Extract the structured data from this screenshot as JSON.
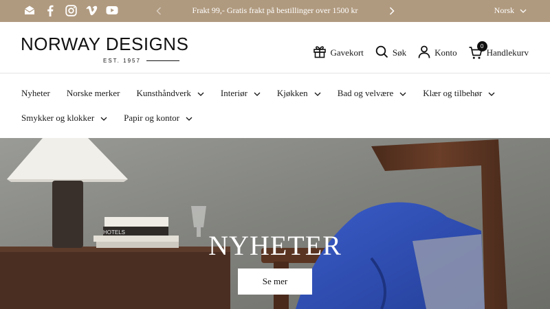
{
  "announcement": {
    "text": "Frakt 99,- Gratis frakt på bestillinger over 1500 kr",
    "language": "Norsk",
    "social_icons": [
      "email-icon",
      "facebook-icon",
      "instagram-icon",
      "vimeo-icon",
      "youtube-icon"
    ]
  },
  "header": {
    "logo_title": "NORWAY DESIGNS",
    "logo_subtitle": "EST. 1957",
    "gift_card": "Gavekort",
    "search": "Søk",
    "account": "Konto",
    "cart": "Handlekurv",
    "cart_count": "0"
  },
  "nav": {
    "items": [
      {
        "label": "Nyheter"
      },
      {
        "label": "Norske merker"
      },
      {
        "label": "Kunsthåndverk"
      },
      {
        "label": "Interiør"
      },
      {
        "label": "Kjøkken"
      },
      {
        "label": "Bad og velvære"
      },
      {
        "label": "Klær og tilbehør"
      },
      {
        "label": "Smykker og klokker"
      },
      {
        "label": "Papir og kontor"
      }
    ]
  },
  "hero": {
    "title": "NYHETER",
    "button": "Se mer",
    "book_label": "HOTELS"
  },
  "colors": {
    "topbar_bg": "#b09a7f",
    "hero_wall": "#7c7d78",
    "chair_wood": "#5a3422",
    "blanket_blue": "#2f4fb4"
  }
}
